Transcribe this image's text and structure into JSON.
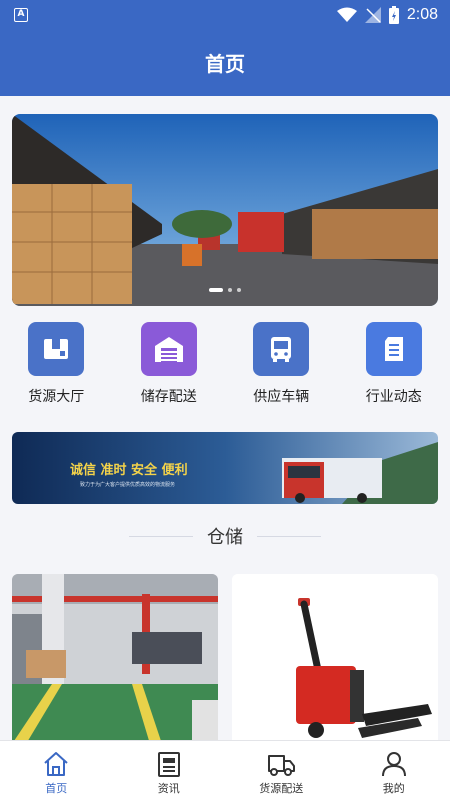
{
  "status_bar": {
    "time": "2:08"
  },
  "header": {
    "title": "首页"
  },
  "quick_menu": [
    {
      "label": "货源大厅",
      "icon": "package-icon",
      "color": "#4a72c8"
    },
    {
      "label": "储存配送",
      "icon": "warehouse-icon",
      "color": "#8a5ad8"
    },
    {
      "label": "供应车辆",
      "icon": "bus-icon",
      "color": "#4a72c8"
    },
    {
      "label": "行业动态",
      "icon": "document-icon",
      "color": "#4a7ae0"
    }
  ],
  "ad": {
    "slogan": "诚信 准时 安全 便利",
    "subtitle": "致力于为广大客户提供优质高效的物流服务"
  },
  "section": {
    "title": "仓储"
  },
  "tabs": [
    {
      "label": "首页",
      "icon": "home-icon",
      "active": true
    },
    {
      "label": "资讯",
      "icon": "news-icon",
      "active": false
    },
    {
      "label": "货源配送",
      "icon": "truck-icon",
      "active": false
    },
    {
      "label": "我的",
      "icon": "user-icon",
      "active": false
    }
  ],
  "colors": {
    "brand": "#3a68c4",
    "background": "#f4f5f9"
  }
}
